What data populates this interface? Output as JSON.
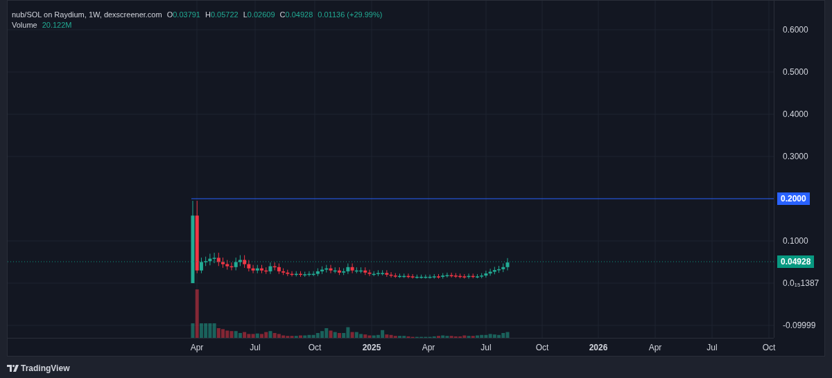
{
  "legend": {
    "symbol": "nub/SOL on Raydium, 1W, dexscreener.com",
    "ohlc": [
      {
        "label": "O",
        "value": "0.03791"
      },
      {
        "label": "H",
        "value": "0.05722"
      },
      {
        "label": "L",
        "value": "0.02609"
      },
      {
        "label": "C",
        "value": "0.04928"
      }
    ],
    "change": "0.01136 (+29.99%)"
  },
  "volume": {
    "label": "Volume",
    "value": "20.122M"
  },
  "price_axis": [
    "0.6000",
    "0.5000",
    "0.4000",
    "0.3000",
    "0.1000",
    "0.0₁₅1387",
    "-0.09999"
  ],
  "price_markers": [
    {
      "kind": "line",
      "value": "0.2000",
      "color": "#2962ff"
    },
    {
      "kind": "last",
      "value": "0.04928",
      "color": "#089981"
    }
  ],
  "time_axis": [
    {
      "label": "Apr",
      "bold": false
    },
    {
      "label": "Jul",
      "bold": false
    },
    {
      "label": "Oct",
      "bold": false
    },
    {
      "label": "2025",
      "bold": true
    },
    {
      "label": "Apr",
      "bold": false
    },
    {
      "label": "Jul",
      "bold": false
    },
    {
      "label": "Oct",
      "bold": false
    },
    {
      "label": "2026",
      "bold": true
    },
    {
      "label": "Apr",
      "bold": false
    },
    {
      "label": "Jul",
      "bold": false
    },
    {
      "label": "Oct",
      "bold": false
    }
  ],
  "brand": "TradingView"
}
